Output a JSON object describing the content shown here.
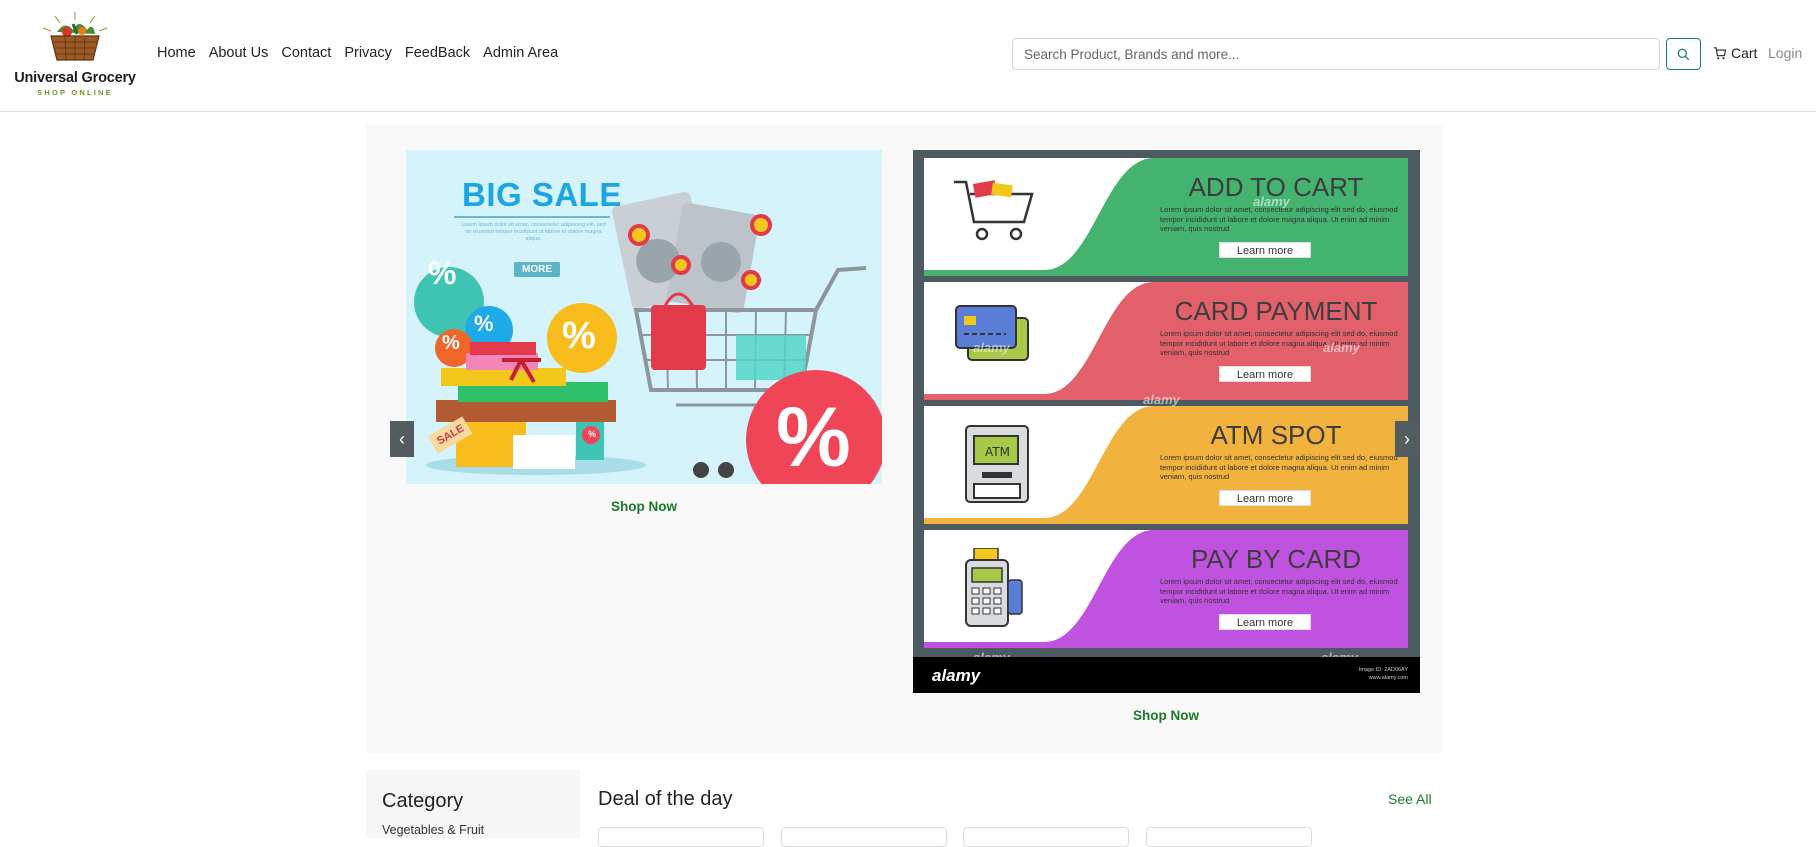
{
  "brand": {
    "title": "Universal Grocery",
    "subtitle": "SHOP ONLINE"
  },
  "nav": {
    "items": [
      "Home",
      "About Us",
      "Contact",
      "Privacy",
      "FeedBack",
      "Admin Area"
    ]
  },
  "search": {
    "placeholder": "Search Product, Brands and more..."
  },
  "header": {
    "cart_label": "Cart",
    "login_label": "Login"
  },
  "hero": {
    "left_banner": {
      "heading": "BIG SALE",
      "body": "Lorem ipsum dolor sit amet, consectetur adipiscing elit, sed do eiusmod tempor incididunt ut labore et dolore magna aliqua.",
      "more_label": "MORE",
      "tag_label": "SALE",
      "percent_symbol": "%",
      "cta": "Shop Now"
    },
    "right_banner": {
      "strips": [
        {
          "title": "ADD TO CART",
          "body": "Lorem ipsum dolor sit amet, consectetur adipiscing elit sed do, eiusmod tempor incididunt ut labore et dolore magna aliqua. Ut enim ad minim veniam, quis nostrud",
          "button": "Learn more",
          "color": "#44b36f",
          "icon": "shopping-cart-icon"
        },
        {
          "title": "CARD PAYMENT",
          "body": "Lorem ipsum dolor sit amet, consectetur adipiscing elit sed do, eiusmod tempor incididunt ut labore et dolore magna aliqua. Ut enim ad minim veniam, quis nostrud",
          "button": "Learn more",
          "color": "#e2606a",
          "icon": "credit-card-icon"
        },
        {
          "title": "ATM SPOT",
          "body": "Lorem ipsum dolor sit amet, consectetur adipiscing elit sed do, eiusmod tempor incididunt ut labore et dolore magna aliqua. Ut enim ad minim veniam, quis nostrud",
          "button": "Learn more",
          "color": "#f2b23e",
          "icon": "atm-icon"
        },
        {
          "title": "PAY BY CARD",
          "body": "Lorem ipsum dolor sit amet, consectetur adipiscing elit sed do, eiusmod tempor incididunt ut labore et dolore magna aliqua. Ut enim ad minim veniam, quis nostrud",
          "button": "Learn more",
          "color": "#c052e0",
          "icon": "card-terminal-icon"
        }
      ],
      "watermark": "alamy",
      "footer_logo": "alamy",
      "image_id": "Image ID: 2AD06AY",
      "site": "www.alamy.com",
      "cta": "Shop Now"
    },
    "prev_label": "‹",
    "next_label": "›"
  },
  "category": {
    "title": "Category",
    "items": [
      "Vegetables & Fruit"
    ]
  },
  "deals": {
    "title": "Deal of the day",
    "see_all": "See All"
  },
  "colors": {
    "accent": "#198754",
    "link_green": "#1a7a2a",
    "hero_bg": "#f8f8f8"
  }
}
